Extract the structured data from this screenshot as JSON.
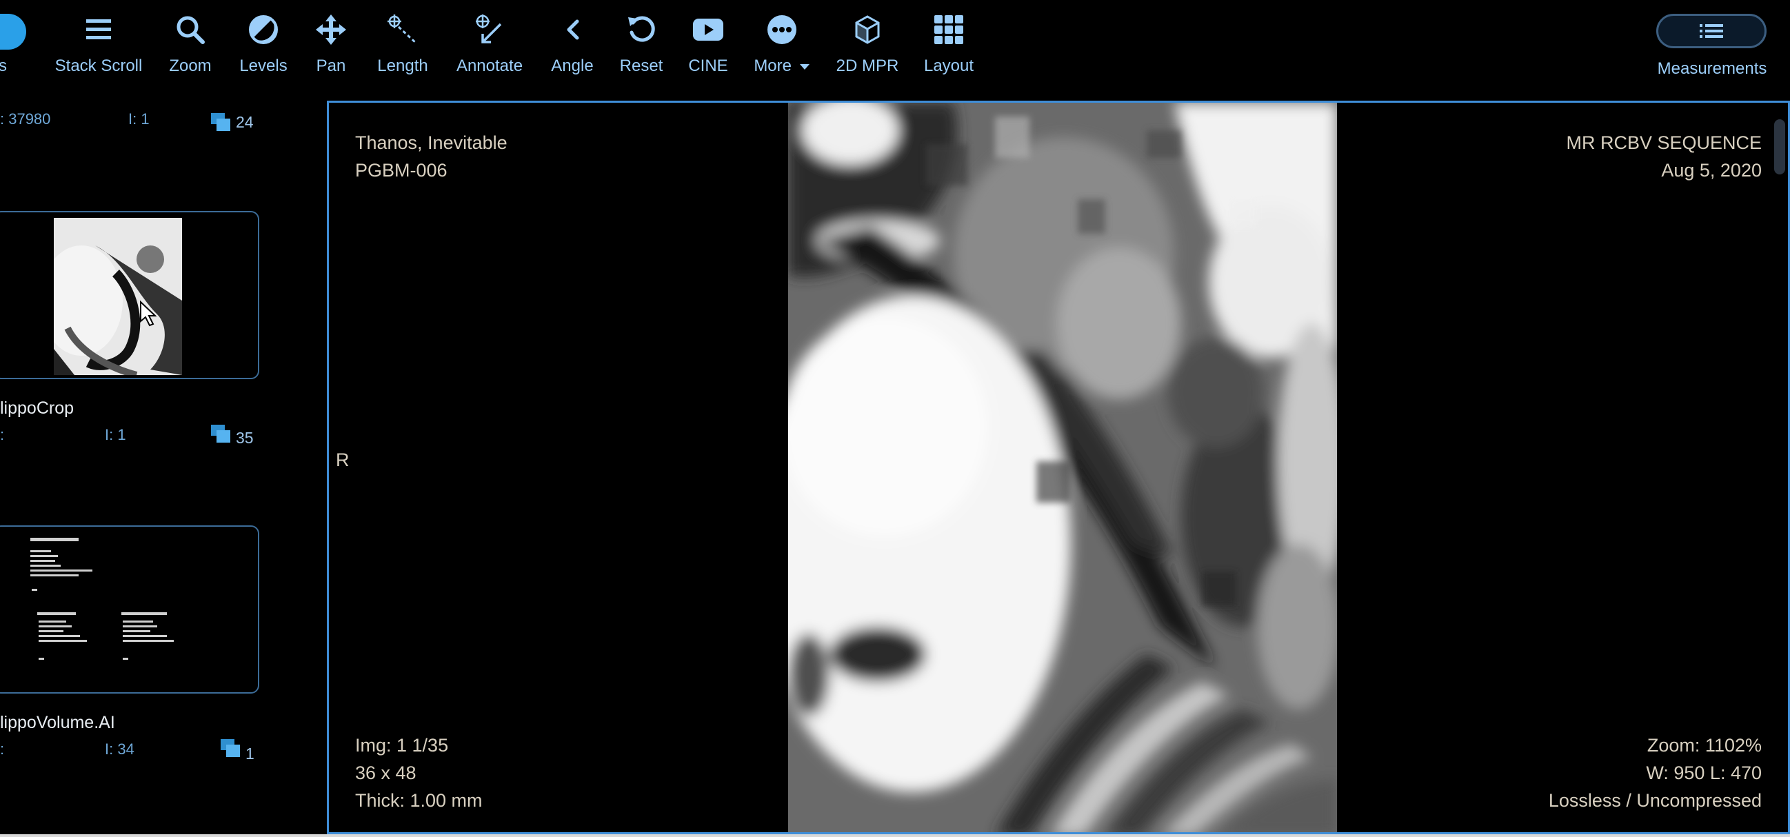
{
  "toolbar": {
    "partial_left_label": "s",
    "tools": [
      {
        "label": "Stack Scroll",
        "icon": "stack-scroll-icon"
      },
      {
        "label": "Zoom",
        "icon": "zoom-icon"
      },
      {
        "label": "Levels",
        "icon": "levels-icon"
      },
      {
        "label": "Pan",
        "icon": "pan-icon"
      },
      {
        "label": "Length",
        "icon": "length-icon"
      },
      {
        "label": "Annotate",
        "icon": "annotate-icon"
      },
      {
        "label": "Angle",
        "icon": "angle-icon"
      },
      {
        "label": "Reset",
        "icon": "reset-icon"
      },
      {
        "label": "CINE",
        "icon": "cine-icon"
      },
      {
        "label": "More",
        "icon": "more-icon"
      },
      {
        "label": "2D MPR",
        "icon": "mpr-icon"
      },
      {
        "label": "Layout",
        "icon": "layout-icon"
      }
    ],
    "measurements_label": "Measurements"
  },
  "series_panel": {
    "top_partial": {
      "meta_a": ": 37980",
      "meta_b": "I: 1",
      "count": "24"
    },
    "series": [
      {
        "name": "lippoCrop",
        "meta_a": ":",
        "meta_b": "I: 1",
        "count": "35"
      },
      {
        "name": "lippoVolume.AI",
        "meta_a": ":",
        "meta_b": "I: 34",
        "count": "1"
      }
    ]
  },
  "viewport": {
    "patient_name": "Thanos, Inevitable",
    "patient_id": "PGBM-006",
    "series_description": "MR RCBV SEQUENCE",
    "study_date": "Aug 5, 2020",
    "orientation_marker": "R",
    "image_index": "Img: 1 1/35",
    "dimensions": "36 x 48",
    "thickness": "Thick: 1.00 mm",
    "zoom": "Zoom: 1102%",
    "window_level": "W: 950 L: 470",
    "compression": "Lossless / Uncompressed"
  },
  "colors": {
    "accent": "#3f8ed8",
    "toolbar_text": "#9ccef9",
    "overlay_text": "#d8d0c0"
  }
}
